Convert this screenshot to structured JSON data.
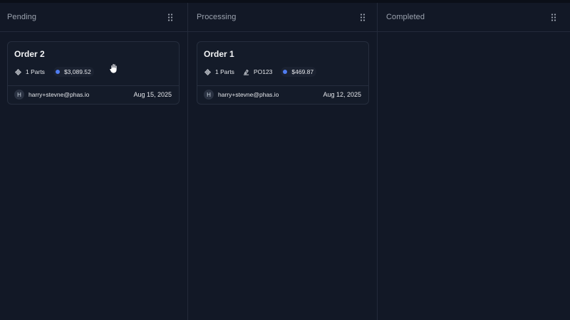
{
  "columns": [
    {
      "title": "Pending",
      "cards": [
        {
          "title": "Order 2",
          "parts": "1 Parts",
          "po": null,
          "price": "$3,089.52",
          "avatar": "H",
          "email": "harry+stevne@phas.io",
          "date": "Aug 15, 2025"
        }
      ]
    },
    {
      "title": "Processing",
      "cards": [
        {
          "title": "Order 1",
          "parts": "1 Parts",
          "po": "PO123",
          "price": "$469.87",
          "avatar": "H",
          "email": "harry+stevne@phas.io",
          "date": "Aug 12, 2025"
        }
      ]
    },
    {
      "title": "Completed",
      "cards": []
    }
  ],
  "colors": {
    "background": "#121826",
    "card": "#141b29",
    "accent_dot": "#4f7cf0",
    "border": "#232a3a"
  },
  "icons": {
    "column_menu": "grip-vertical-icon",
    "parts": "component-icon",
    "po": "receipt-icon",
    "price": "price-dot-icon",
    "cursor": "hand-grab-cursor"
  }
}
